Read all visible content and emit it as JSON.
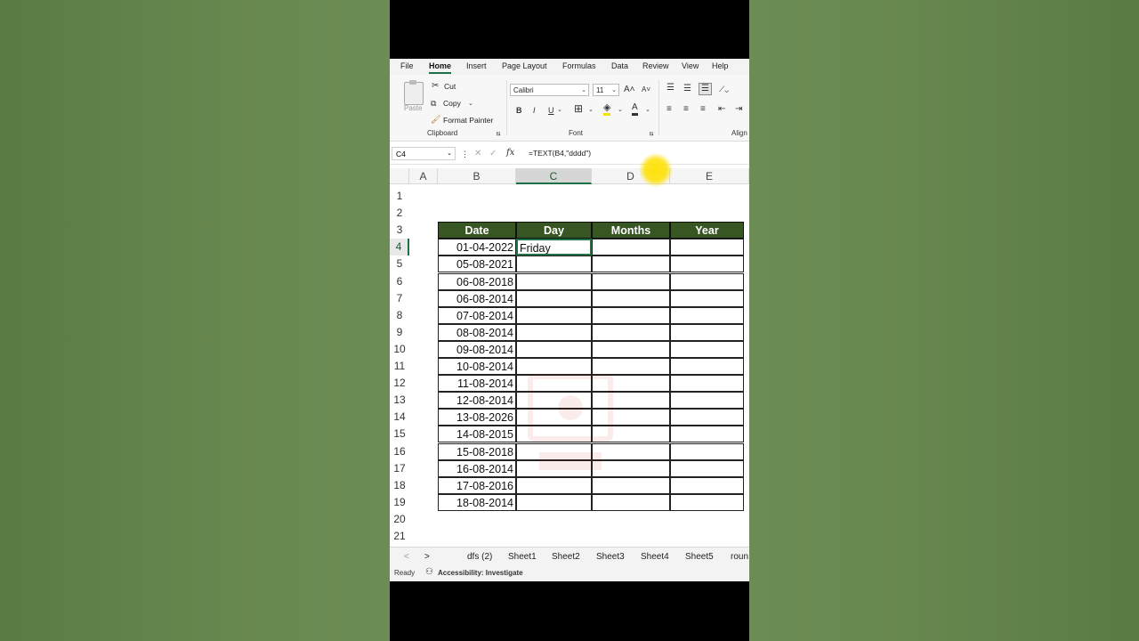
{
  "ribbon_tabs": [
    "File",
    "Home",
    "Insert",
    "Page Layout",
    "Formulas",
    "Data",
    "Review",
    "View",
    "Help"
  ],
  "clipboard": {
    "paste": "Paste",
    "cut": "Cut",
    "copy": "Copy",
    "format_painter": "Format Painter",
    "group": "Clipboard"
  },
  "font": {
    "name": "Calibri",
    "size": "11",
    "group": "Font",
    "bold": "B",
    "italic": "I",
    "underline": "U",
    "grow": "A",
    "color": "A"
  },
  "alignment": {
    "group": "Align"
  },
  "formula_bar": {
    "name_box": "C4",
    "fx": "fx",
    "formula": "=TEXT(B4,\"dddd\")"
  },
  "columns": [
    "A",
    "B",
    "C",
    "D",
    "E"
  ],
  "rows": [
    "1",
    "2",
    "3",
    "4",
    "5",
    "6",
    "7",
    "8",
    "9",
    "10",
    "11",
    "12",
    "13",
    "14",
    "15",
    "16",
    "17",
    "18",
    "19",
    "20",
    "21"
  ],
  "table": {
    "headers": [
      "Date",
      "Day",
      "Months",
      "Year"
    ],
    "dates": [
      "01-04-2022",
      "05-08-2021",
      "06-08-2018",
      "06-08-2014",
      "07-08-2014",
      "08-08-2014",
      "09-08-2014",
      "10-08-2014",
      "11-08-2014",
      "12-08-2014",
      "13-08-2026",
      "14-08-2015",
      "15-08-2018",
      "16-08-2014",
      "17-08-2016",
      "18-08-2014"
    ],
    "day_c4": "Friday"
  },
  "sheet_tabs": [
    "dfs (2)",
    "Sheet1",
    "Sheet2",
    "Sheet3",
    "Sheet4",
    "Sheet5",
    "roun"
  ],
  "sheet_nav": {
    "prev": "<",
    "next": ">"
  },
  "status": {
    "ready": "Ready",
    "accessibility": "Accessibility: Investigate"
  },
  "colors": {
    "header_fill": "#375623",
    "accent": "#1e7145",
    "background": "#5f8048",
    "cursor": "#ffe000"
  }
}
